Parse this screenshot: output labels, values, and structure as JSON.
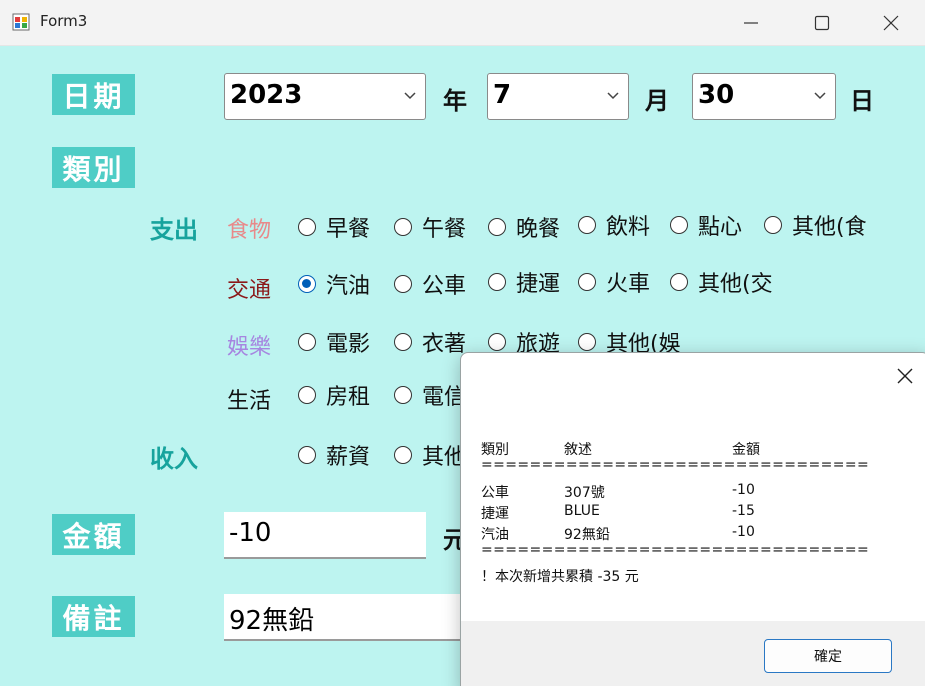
{
  "window": {
    "title": "Form3"
  },
  "labels": {
    "date": "日期",
    "category": "類別",
    "amount": "金額",
    "note": "備註",
    "year_unit": "年",
    "month_unit": "月",
    "day_unit": "日",
    "amount_unit": "元"
  },
  "date": {
    "year": "2023",
    "month": "7",
    "day": "30"
  },
  "sections": {
    "expense": "支出",
    "income": "收入"
  },
  "categories": {
    "food": {
      "label": "食物",
      "color": "#e8898a",
      "options": [
        "早餐",
        "午餐",
        "晚餐",
        "飲料",
        "點心",
        "其他(食"
      ]
    },
    "transport": {
      "label": "交通",
      "color": "#8b1a1a",
      "options": [
        "汽油",
        "公車",
        "捷運",
        "火車",
        "其他(交"
      ],
      "selected": "汽油"
    },
    "entertainment": {
      "label": "娛樂",
      "color": "#a686e0",
      "options": [
        "電影",
        "衣著",
        "旅遊",
        "其他(娛"
      ]
    },
    "living": {
      "label": "生活",
      "color": "#111111",
      "options": [
        "房租",
        "電信"
      ]
    },
    "income": {
      "options": [
        "薪資",
        "其他"
      ]
    }
  },
  "amount": {
    "value": "-10"
  },
  "note": {
    "value": "92無鉛"
  },
  "dialog": {
    "headers": [
      "類別",
      "敘述",
      "金額"
    ],
    "separator": "================================",
    "rows": [
      {
        "category": "公車",
        "desc": "307號",
        "amount": "-10"
      },
      {
        "category": "捷運",
        "desc": "BLUE",
        "amount": "-15"
      },
      {
        "category": "汽油",
        "desc": "92無鉛",
        "amount": "-10"
      }
    ],
    "summary": "！本次新增共累積 -35 元",
    "ok_label": "確定"
  }
}
